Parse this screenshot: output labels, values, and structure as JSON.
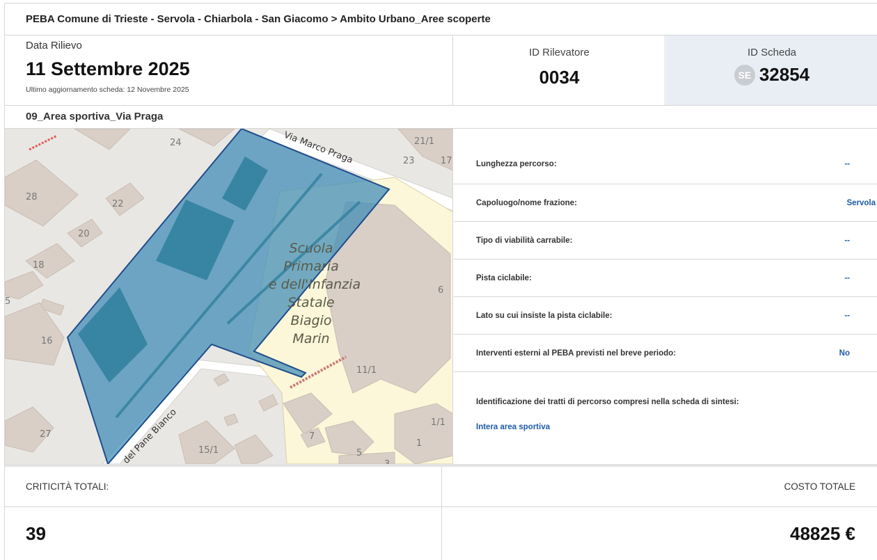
{
  "breadcrumb": "PEBA Comune di Trieste - Servola - Chiarbola - San Giacomo > Ambito Urbano_Aree scoperte",
  "header": {
    "date_label": "Data Rilievo",
    "date_value": "11 Settembre 2025",
    "last_update": "Ultimo aggiornamento scheda: 12 Novembre 2025",
    "rilevatore_label": "ID Rilevatore",
    "rilevatore_value": "0034",
    "scheda_label": "ID Scheda",
    "scheda_badge": "SE",
    "scheda_value": "32854"
  },
  "area_title": "09_Area sportiva_Via Praga",
  "map": {
    "street_1": "Via Marco Praga",
    "street_2": "del Pane Bianco",
    "school_lines": [
      "Scuola",
      "Primaria",
      "e dell'Infanzia",
      "Statale",
      "Biagio",
      "Marin"
    ],
    "house_numbers": [
      "24",
      "21/1",
      "23",
      "17",
      "28",
      "22",
      "20",
      "18",
      "5",
      "16",
      "6",
      "11/1",
      "27",
      "15/1",
      "7",
      "1/1",
      "1",
      "5",
      "3"
    ],
    "colors": {
      "background": "#e9e7e3",
      "building": "#d9cfc7",
      "school_area": "#fbf7d8",
      "selection_fill": "#3d8bb7",
      "selection_stroke": "#1d4c8c",
      "court": "#2f7f9e"
    }
  },
  "properties": [
    {
      "key": "Lunghezza percorso:",
      "value": "--"
    },
    {
      "key": "Capoluogo/nome frazione:",
      "value": "Servola"
    },
    {
      "key": "Tipo di viabilità carrabile:",
      "value": "--"
    },
    {
      "key": "Pista ciclabile:",
      "value": "--"
    },
    {
      "key": "Lato su cui insiste la pista ciclabile:",
      "value": "--"
    },
    {
      "key": "Interventi esterni al PEBA previsti nel breve periodo:",
      "value": "No"
    }
  ],
  "tratti": {
    "label": "Identificazione dei tratti di percorso compresi nella scheda di sintesi:",
    "link": "Intera area sportiva"
  },
  "totals": {
    "criticita_label": "CRITICITÀ TOTALI:",
    "criticita_value": "39",
    "costo_label": "COSTO TOTALE",
    "costo_value": "48825 €"
  },
  "accent_color": "#1d5aa8"
}
